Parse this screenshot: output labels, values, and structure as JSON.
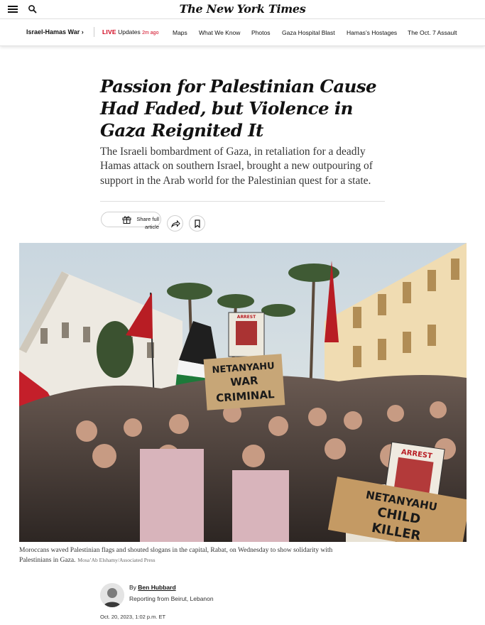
{
  "header": {
    "masthead": "The New York Times",
    "menu_icon": "hamburger-menu-icon",
    "search_icon": "search-icon"
  },
  "nav": {
    "section": "Israel-Hamas War ›",
    "live_label": "LIVE",
    "updates_label": "Updates",
    "updated_ago": "2m ago",
    "links": [
      "Maps",
      "What We Know",
      "Photos",
      "Gaza Hospital Blast",
      "Hamas’s Hostages",
      "The Oct. 7 Assault"
    ]
  },
  "article": {
    "headline": "Passion for Palestinian Cause Had Faded, but Violence in Gaza Reignited It",
    "summary": "The Israeli bombardment of Gaza, in retaliation for a deadly Hamas attack on southern Israel, brought a new outpouring of support in the Arab world for the Palestinian quest for a state.",
    "share": {
      "line1": "Share full",
      "line2": "article",
      "gift_icon": "gift-icon",
      "forward_icon": "share-arrow-icon",
      "bookmark_icon": "bookmark-icon"
    },
    "photo": {
      "sign_1": "ARREST",
      "sign_2": "NETANYAHU",
      "sign_3": "WAR",
      "sign_4": "CRIMINAL",
      "sign_5": "ARREST",
      "sign_6": "NETANYAHU",
      "sign_7": "CHILD",
      "sign_8": "KILLER"
    },
    "caption": "Moroccans waved Palestinian flags and shouted slogans in the capital, Rabat, on Wednesday to show solidarity with Palestinians in Gaza.",
    "credit": "Mosa’Ab Elshamy/Associated Press",
    "byline_prefix": "By",
    "author": "Ben Hubbard",
    "reporting": "Reporting from Beirut, Lebanon",
    "date": "Oct. 20, 2023, 1:02 p.m. ET"
  },
  "colors": {
    "live_red": "#d0021b",
    "text": "#121212",
    "rule": "#dfdfdf"
  }
}
